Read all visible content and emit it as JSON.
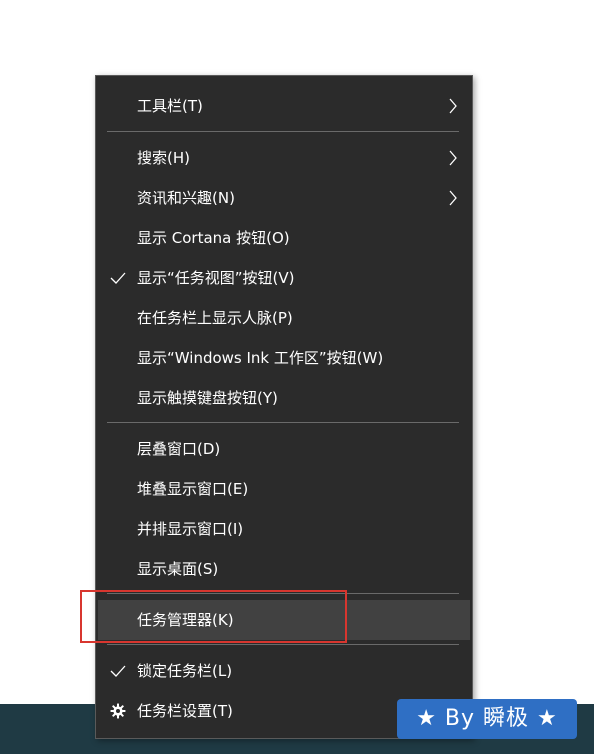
{
  "menu": {
    "items": [
      {
        "label": "工具栏(T)",
        "submenu": true,
        "checked": false
      },
      {
        "label": "搜索(H)",
        "submenu": true,
        "checked": false
      },
      {
        "label": "资讯和兴趣(N)",
        "submenu": true,
        "checked": false
      },
      {
        "label": "显示 Cortana 按钮(O)",
        "submenu": false,
        "checked": false
      },
      {
        "label": "显示“任务视图”按钮(V)",
        "submenu": false,
        "checked": true
      },
      {
        "label": "在任务栏上显示人脉(P)",
        "submenu": false,
        "checked": false
      },
      {
        "label": "显示“Windows Ink 工作区”按钮(W)",
        "submenu": false,
        "checked": false
      },
      {
        "label": "显示触摸键盘按钮(Y)",
        "submenu": false,
        "checked": false
      },
      {
        "label": "层叠窗口(D)",
        "submenu": false,
        "checked": false
      },
      {
        "label": "堆叠显示窗口(E)",
        "submenu": false,
        "checked": false
      },
      {
        "label": "并排显示窗口(I)",
        "submenu": false,
        "checked": false
      },
      {
        "label": "显示桌面(S)",
        "submenu": false,
        "checked": false
      },
      {
        "label": "任务管理器(K)",
        "submenu": false,
        "checked": false,
        "hovered": true
      },
      {
        "label": "锁定任务栏(L)",
        "submenu": false,
        "checked": true
      },
      {
        "label": "任务栏设置(T)",
        "submenu": false,
        "checked": false,
        "icon": "gear-icon"
      }
    ]
  },
  "watermark": {
    "text": "★ By 瞬极 ★"
  },
  "colors": {
    "menu_background": "#2b2b2b",
    "menu_hover": "#414141",
    "separator": "#6a6a6a",
    "highlight_border": "#d8362f",
    "badge_background": "#2f6fc4",
    "taskbar": "#1f3a44"
  }
}
